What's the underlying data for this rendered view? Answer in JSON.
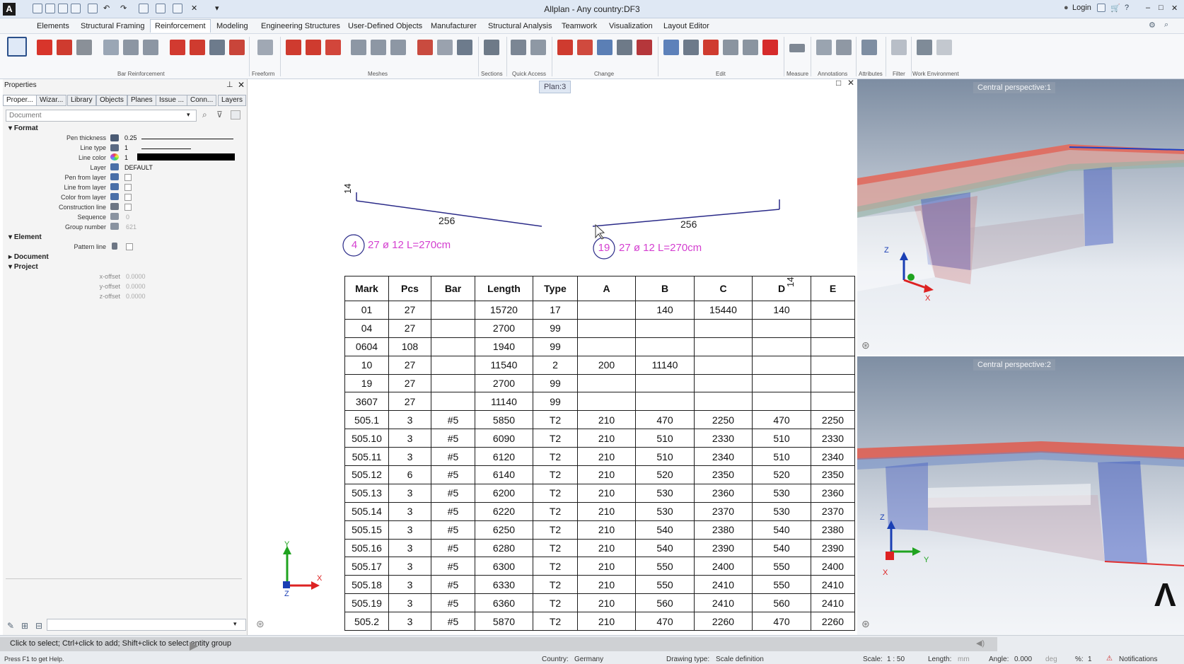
{
  "window": {
    "title": "Allplan - Any country:DF3",
    "login_label": "Login"
  },
  "menu": {
    "tabs": [
      "Elements",
      "Structural Framing",
      "Reinforcement",
      "Modeling",
      "Engineering Structures",
      "User-Defined Objects",
      "Manufacturer",
      "Structural Analysis",
      "Teamwork",
      "Visualization",
      "Layout Editor"
    ],
    "active": "Reinforcement"
  },
  "ribbon": {
    "groups": [
      "Bar Reinforcement",
      "Freeform",
      "Meshes",
      "Sections",
      "Quick Access",
      "Change",
      "Edit",
      "Measure",
      "Annotations",
      "Attributes",
      "Filter",
      "Work Environment"
    ]
  },
  "properties": {
    "title": "Properties",
    "tabs": [
      "Proper...",
      "Wizar...",
      "Library",
      "Objects",
      "Planes",
      "Issue ...",
      "Conn...",
      "Layers"
    ],
    "document_placeholder": "Document",
    "sections": {
      "format": "Format",
      "element": "Element",
      "document": "Document",
      "project": "Project"
    },
    "format_rows": [
      {
        "label": "Pen thickness",
        "value": "0.25"
      },
      {
        "label": "Line type",
        "value": "1"
      },
      {
        "label": "Line color",
        "value": "1"
      },
      {
        "label": "Layer",
        "value": "DEFAULT"
      },
      {
        "label": "Pen from layer",
        "value": ""
      },
      {
        "label": "Line from layer",
        "value": ""
      },
      {
        "label": "Color from layer",
        "value": ""
      },
      {
        "label": "Construction line",
        "value": ""
      },
      {
        "label": "Sequence",
        "value": "0"
      },
      {
        "label": "Group number",
        "value": "621"
      }
    ],
    "element_rows": [
      {
        "label": "Pattern line",
        "value": ""
      }
    ],
    "project_rows": [
      {
        "label": "x-offset",
        "value": "0.0000"
      },
      {
        "label": "y-offset",
        "value": "0.0000"
      },
      {
        "label": "z-offset",
        "value": "0.0000"
      }
    ]
  },
  "drawing": {
    "plan_label": "Plan:3",
    "bar_left": {
      "dim_end": "14",
      "dim_len": "256",
      "mark": "4",
      "text": "27 ø 12 L=270cm"
    },
    "bar_right": {
      "dim_end": "14",
      "dim_len": "256",
      "mark": "19",
      "text": "27 ø 12 L=270cm"
    },
    "table": {
      "headers": [
        "Mark",
        "Pcs",
        "Bar",
        "Length",
        "Type",
        "A",
        "B",
        "C",
        "D",
        "E"
      ],
      "rows": [
        [
          "01",
          "27",
          "",
          "15720",
          "17",
          "",
          "140",
          "15440",
          "140",
          ""
        ],
        [
          "04",
          "27",
          "",
          "2700",
          "99",
          "",
          "",
          "",
          "",
          ""
        ],
        [
          "0604",
          "108",
          "",
          "1940",
          "99",
          "",
          "",
          "",
          "",
          ""
        ],
        [
          "10",
          "27",
          "",
          "11540",
          "2",
          "200",
          "11140",
          "",
          "",
          ""
        ],
        [
          "19",
          "27",
          "",
          "2700",
          "99",
          "",
          "",
          "",
          "",
          ""
        ],
        [
          "3607",
          "27",
          "",
          "11140",
          "99",
          "",
          "",
          "",
          "",
          ""
        ],
        [
          "505.1",
          "3",
          "#5",
          "5850",
          "T2",
          "210",
          "470",
          "2250",
          "470",
          "2250"
        ],
        [
          "505.10",
          "3",
          "#5",
          "6090",
          "T2",
          "210",
          "510",
          "2330",
          "510",
          "2330"
        ],
        [
          "505.11",
          "3",
          "#5",
          "6120",
          "T2",
          "210",
          "510",
          "2340",
          "510",
          "2340"
        ],
        [
          "505.12",
          "6",
          "#5",
          "6140",
          "T2",
          "210",
          "520",
          "2350",
          "520",
          "2350"
        ],
        [
          "505.13",
          "3",
          "#5",
          "6200",
          "T2",
          "210",
          "530",
          "2360",
          "530",
          "2360"
        ],
        [
          "505.14",
          "3",
          "#5",
          "6220",
          "T2",
          "210",
          "530",
          "2370",
          "530",
          "2370"
        ],
        [
          "505.15",
          "3",
          "#5",
          "6250",
          "T2",
          "210",
          "540",
          "2380",
          "540",
          "2380"
        ],
        [
          "505.16",
          "3",
          "#5",
          "6280",
          "T2",
          "210",
          "540",
          "2390",
          "540",
          "2390"
        ],
        [
          "505.17",
          "3",
          "#5",
          "6300",
          "T2",
          "210",
          "550",
          "2400",
          "550",
          "2400"
        ],
        [
          "505.18",
          "3",
          "#5",
          "6330",
          "T2",
          "210",
          "550",
          "2410",
          "550",
          "2410"
        ],
        [
          "505.19",
          "3",
          "#5",
          "6360",
          "T2",
          "210",
          "560",
          "2410",
          "560",
          "2410"
        ],
        [
          "505.2",
          "3",
          "#5",
          "5870",
          "T2",
          "210",
          "470",
          "2260",
          "470",
          "2260"
        ]
      ]
    },
    "axis": {
      "x": "X",
      "y": "Y",
      "z": "Z"
    }
  },
  "views": [
    {
      "label": "Central perspective:1",
      "axes": [
        "Z",
        "X"
      ]
    },
    {
      "label": "Central perspective:2",
      "axes": [
        "Z",
        "Y",
        "X"
      ]
    }
  ],
  "status": {
    "hint": "Click to select; Ctrl+click to add; Shift+click to select entity group",
    "help": "Press F1 to get Help.",
    "country_label": "Country:",
    "country": "Germany",
    "drawing_type_label": "Drawing type:",
    "drawing_type": "Scale definition",
    "scale_label": "Scale:",
    "scale": "1 : 50",
    "length_label": "Length:",
    "length_unit": "mm",
    "angle_label": "Angle:",
    "angle": "0.000",
    "angle_unit": "deg",
    "percent_label": "%:",
    "percent": "1",
    "notifications": "Notifications"
  },
  "colors": {
    "annotation": "#d43fd0",
    "bar_line": "#2a2a88",
    "rebar_red": "#e03030",
    "rebar_blue": "#2040c0"
  }
}
